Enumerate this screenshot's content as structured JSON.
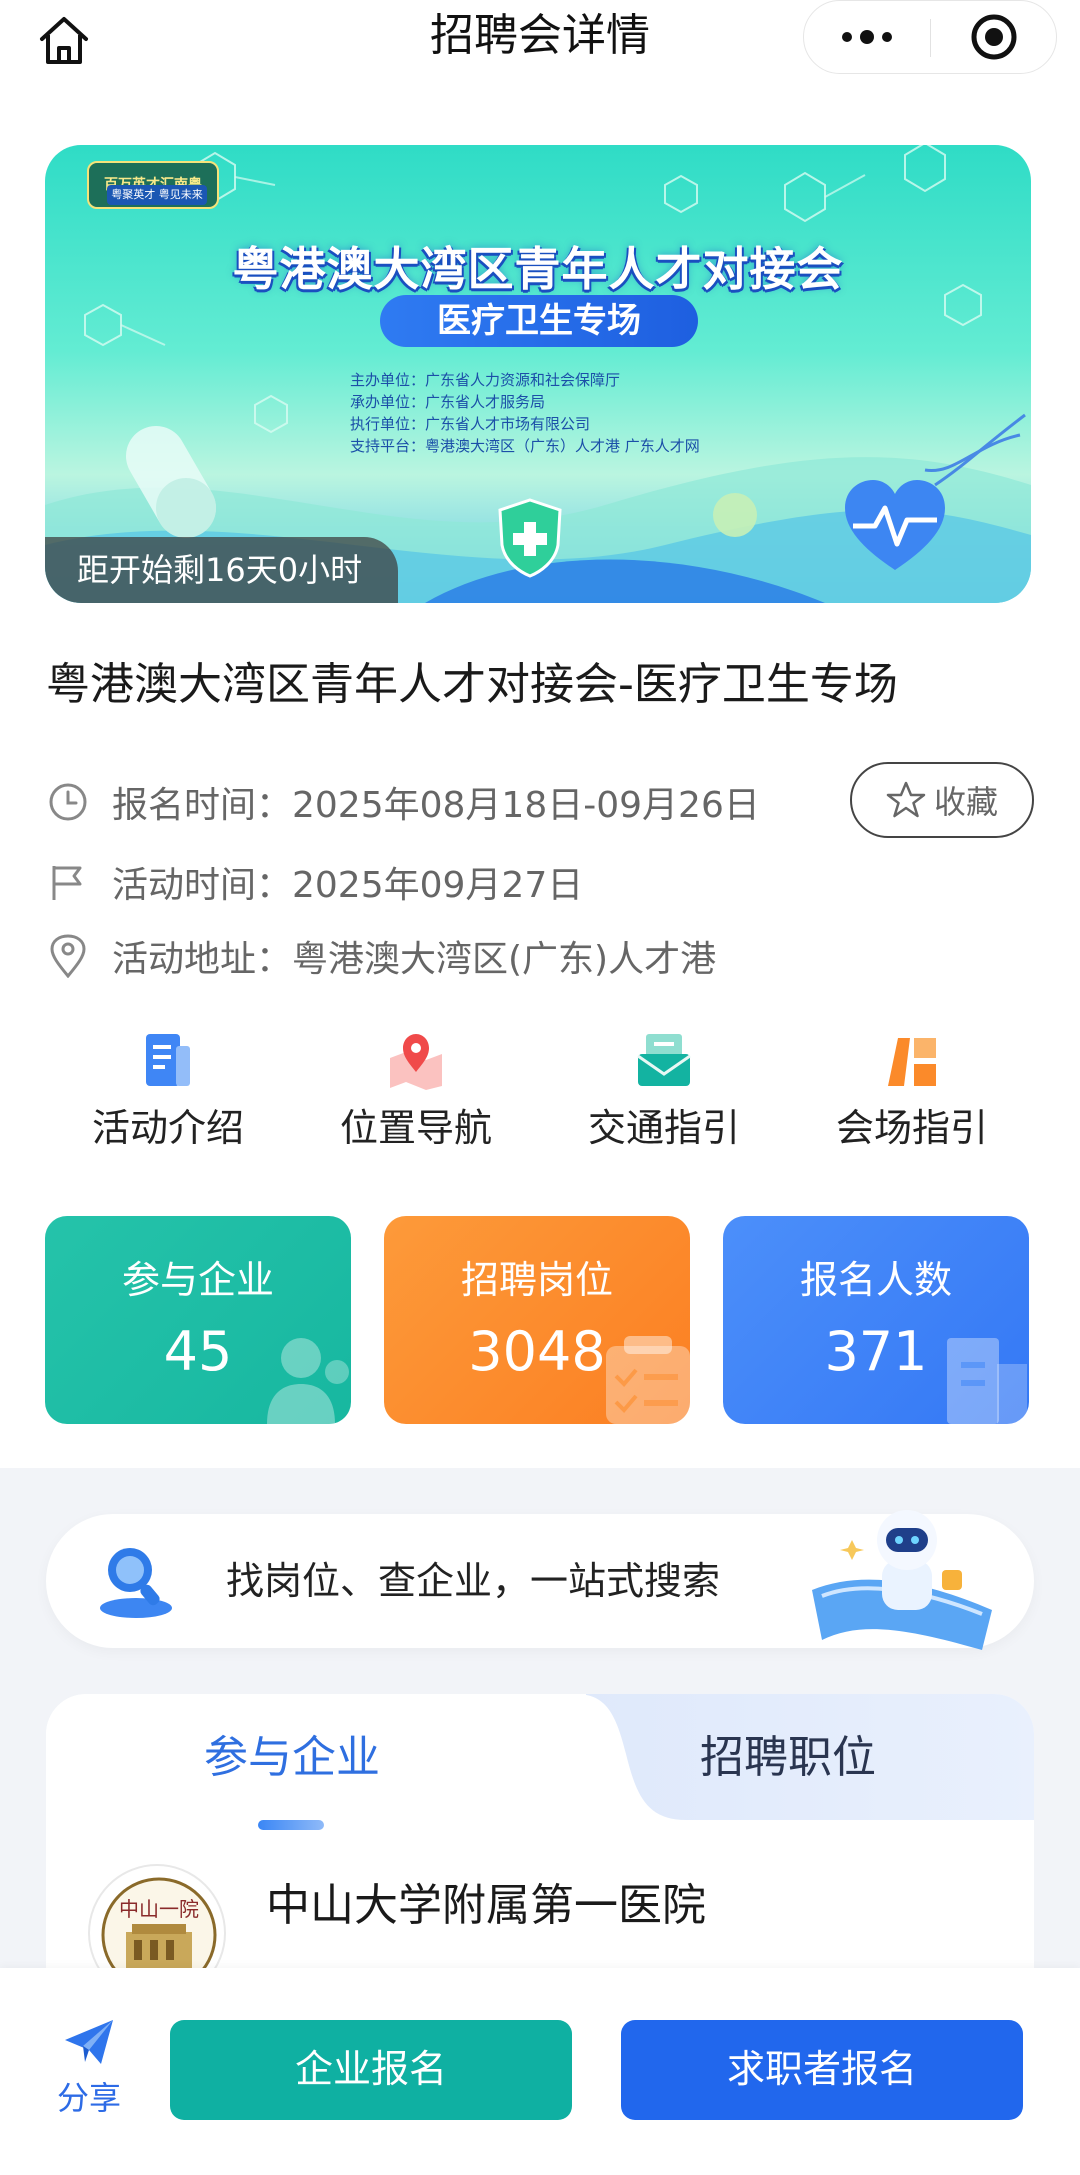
{
  "nav": {
    "title": "招聘会详情",
    "home_icon": "home-icon",
    "more_icon": "more-dots-icon",
    "target_icon": "record-target-icon"
  },
  "banner": {
    "logo_text": "百万英才汇南粤",
    "logo_subtext": "粤聚英才 粤见未来",
    "title": "粤港澳大湾区青年人才对接会",
    "subtitle": "医疗卫生专场",
    "org_lines": [
      "主办单位：广东省人力资源和社会保障厅",
      "承办单位：广东省人才服务局",
      "执行单位：广东省人才市场有限公司",
      "支持平台：粤港澳大湾区（广东）人才港   广东人才网"
    ],
    "countdown": "距开始剩16天0小时"
  },
  "event": {
    "title": "粤港澳大湾区青年人才对接会-医疗卫生专场",
    "registration_time": "报名时间：2025年08月18日-09月26日",
    "activity_time": "活动时间：2025年09月27日",
    "address": "活动地址：粤港澳大湾区(广东)人才港",
    "favorite_label": "收藏"
  },
  "quick_actions": [
    {
      "label": "活动介绍",
      "icon": "document-icon"
    },
    {
      "label": "位置导航",
      "icon": "map-pin-icon"
    },
    {
      "label": "交通指引",
      "icon": "envelope-icon"
    },
    {
      "label": "会场指引",
      "icon": "venue-map-icon"
    }
  ],
  "stats": [
    {
      "label": "参与企业",
      "value": "45",
      "color": "#1fbfa7"
    },
    {
      "label": "招聘岗位",
      "value": "3048",
      "color": "#fb8c2c"
    },
    {
      "label": "报名人数",
      "value": "371",
      "color": "#3a83f8"
    }
  ],
  "search": {
    "text": "找岗位、查企业，一站式搜索"
  },
  "tabs": {
    "companies": "参与企业",
    "positions": "招聘职位"
  },
  "companies": [
    {
      "name": "中山大学附属第一医院",
      "logo_text": "中山一院"
    }
  ],
  "bottom": {
    "share_label": "分享",
    "company_signup": "企业报名",
    "seeker_signup": "求职者报名"
  },
  "colors": {
    "primary_blue": "#2167ed",
    "teal": "#0fb0a2",
    "orange": "#fb8c2c"
  }
}
